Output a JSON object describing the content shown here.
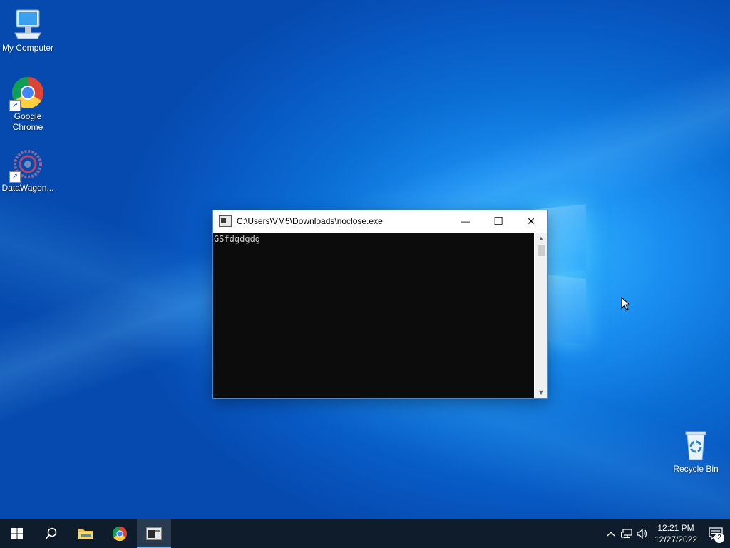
{
  "desktop": {
    "icons": [
      {
        "label": "My Computer",
        "icon": "monitor-icon"
      },
      {
        "label": "Google\nChrome",
        "icon": "chrome-icon"
      },
      {
        "label": "DataWagon...",
        "icon": "datawagon-icon"
      }
    ],
    "recycle_bin": {
      "label": "Recycle Bin",
      "icon": "recycle-bin-icon"
    }
  },
  "console_window": {
    "title": "C:\\Users\\VM5\\Downloads\\noclose.exe",
    "minimize": "—",
    "maximize": "☐",
    "close": "✕",
    "output": "GSfdgdgdg"
  },
  "taskbar": {
    "items": [
      {
        "icon": "windows-start-icon"
      },
      {
        "icon": "search-icon"
      },
      {
        "icon": "file-explorer-icon"
      },
      {
        "icon": "chrome-icon"
      },
      {
        "icon": "console-app-icon",
        "active": true
      }
    ],
    "tray": {
      "chevron": "^",
      "time": "12:21 PM",
      "date": "12/27/2022",
      "notification_count": "2"
    }
  }
}
